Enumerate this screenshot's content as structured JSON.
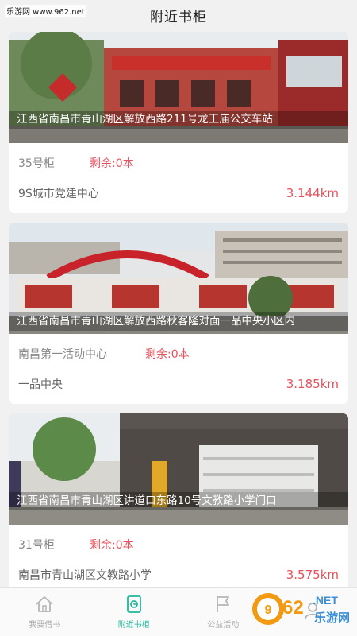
{
  "watermark": "乐游网 www.962.net",
  "header": {
    "title": "附近书柜"
  },
  "cards": [
    {
      "caption": "江西省南昌市青山湖区解放西路211号龙王庙公交车站",
      "cabinet": "35号柜",
      "remain": "剩余:0本",
      "address": "9S城市党建中心",
      "distance": "3.144km"
    },
    {
      "caption": "江西省南昌市青山湖区解放西路秋客隆对面一品中央小区内",
      "cabinet": "南昌第一活动中心",
      "remain": "剩余:0本",
      "address": "一品中央",
      "distance": "3.185km"
    },
    {
      "caption": "江西省南昌市青山湖区讲道口东路10号文教路小学门口",
      "cabinet": "31号柜",
      "remain": "剩余:0本",
      "address": "南昌市青山湖区文教路小学",
      "distance": "3.575km"
    }
  ],
  "tabs": [
    {
      "label": "我要借书",
      "icon": "home-icon"
    },
    {
      "label": "附近书柜",
      "icon": "book-cabinet-icon",
      "active": true
    },
    {
      "label": "公益活动",
      "icon": "flag-icon"
    },
    {
      "label": "",
      "icon": "user-icon"
    }
  ],
  "logo": {
    "number": "962",
    "domain": ".NET",
    "tagline": "乐游网"
  },
  "colors": {
    "accent": "#20b89a",
    "remain": "#e8505b",
    "background": "#f1f1f1"
  }
}
